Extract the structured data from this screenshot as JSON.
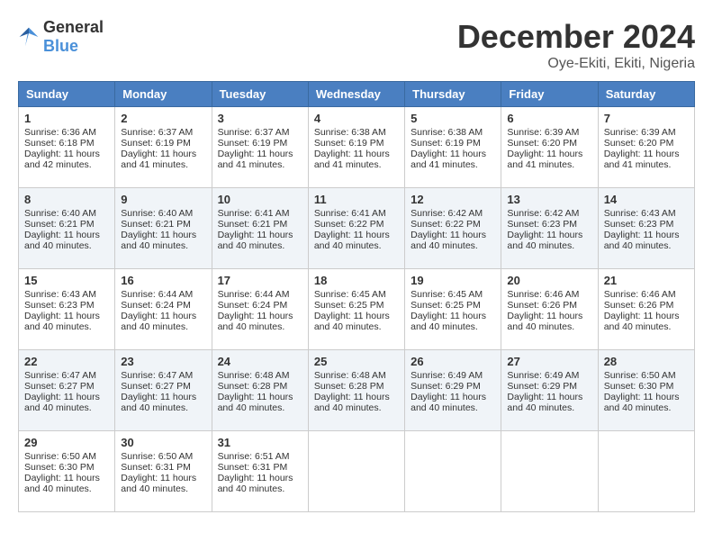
{
  "header": {
    "logo_general": "General",
    "logo_blue": "Blue",
    "month": "December 2024",
    "location": "Oye-Ekiti, Ekiti, Nigeria"
  },
  "weekdays": [
    "Sunday",
    "Monday",
    "Tuesday",
    "Wednesday",
    "Thursday",
    "Friday",
    "Saturday"
  ],
  "weeks": [
    [
      {
        "day": 1,
        "sunrise": "6:36 AM",
        "sunset": "6:18 PM",
        "daylight": "11 hours and 42 minutes."
      },
      {
        "day": 2,
        "sunrise": "6:37 AM",
        "sunset": "6:19 PM",
        "daylight": "11 hours and 41 minutes."
      },
      {
        "day": 3,
        "sunrise": "6:37 AM",
        "sunset": "6:19 PM",
        "daylight": "11 hours and 41 minutes."
      },
      {
        "day": 4,
        "sunrise": "6:38 AM",
        "sunset": "6:19 PM",
        "daylight": "11 hours and 41 minutes."
      },
      {
        "day": 5,
        "sunrise": "6:38 AM",
        "sunset": "6:19 PM",
        "daylight": "11 hours and 41 minutes."
      },
      {
        "day": 6,
        "sunrise": "6:39 AM",
        "sunset": "6:20 PM",
        "daylight": "11 hours and 41 minutes."
      },
      {
        "day": 7,
        "sunrise": "6:39 AM",
        "sunset": "6:20 PM",
        "daylight": "11 hours and 41 minutes."
      }
    ],
    [
      {
        "day": 8,
        "sunrise": "6:40 AM",
        "sunset": "6:21 PM",
        "daylight": "11 hours and 40 minutes."
      },
      {
        "day": 9,
        "sunrise": "6:40 AM",
        "sunset": "6:21 PM",
        "daylight": "11 hours and 40 minutes."
      },
      {
        "day": 10,
        "sunrise": "6:41 AM",
        "sunset": "6:21 PM",
        "daylight": "11 hours and 40 minutes."
      },
      {
        "day": 11,
        "sunrise": "6:41 AM",
        "sunset": "6:22 PM",
        "daylight": "11 hours and 40 minutes."
      },
      {
        "day": 12,
        "sunrise": "6:42 AM",
        "sunset": "6:22 PM",
        "daylight": "11 hours and 40 minutes."
      },
      {
        "day": 13,
        "sunrise": "6:42 AM",
        "sunset": "6:23 PM",
        "daylight": "11 hours and 40 minutes."
      },
      {
        "day": 14,
        "sunrise": "6:43 AM",
        "sunset": "6:23 PM",
        "daylight": "11 hours and 40 minutes."
      }
    ],
    [
      {
        "day": 15,
        "sunrise": "6:43 AM",
        "sunset": "6:23 PM",
        "daylight": "11 hours and 40 minutes."
      },
      {
        "day": 16,
        "sunrise": "6:44 AM",
        "sunset": "6:24 PM",
        "daylight": "11 hours and 40 minutes."
      },
      {
        "day": 17,
        "sunrise": "6:44 AM",
        "sunset": "6:24 PM",
        "daylight": "11 hours and 40 minutes."
      },
      {
        "day": 18,
        "sunrise": "6:45 AM",
        "sunset": "6:25 PM",
        "daylight": "11 hours and 40 minutes."
      },
      {
        "day": 19,
        "sunrise": "6:45 AM",
        "sunset": "6:25 PM",
        "daylight": "11 hours and 40 minutes."
      },
      {
        "day": 20,
        "sunrise": "6:46 AM",
        "sunset": "6:26 PM",
        "daylight": "11 hours and 40 minutes."
      },
      {
        "day": 21,
        "sunrise": "6:46 AM",
        "sunset": "6:26 PM",
        "daylight": "11 hours and 40 minutes."
      }
    ],
    [
      {
        "day": 22,
        "sunrise": "6:47 AM",
        "sunset": "6:27 PM",
        "daylight": "11 hours and 40 minutes."
      },
      {
        "day": 23,
        "sunrise": "6:47 AM",
        "sunset": "6:27 PM",
        "daylight": "11 hours and 40 minutes."
      },
      {
        "day": 24,
        "sunrise": "6:48 AM",
        "sunset": "6:28 PM",
        "daylight": "11 hours and 40 minutes."
      },
      {
        "day": 25,
        "sunrise": "6:48 AM",
        "sunset": "6:28 PM",
        "daylight": "11 hours and 40 minutes."
      },
      {
        "day": 26,
        "sunrise": "6:49 AM",
        "sunset": "6:29 PM",
        "daylight": "11 hours and 40 minutes."
      },
      {
        "day": 27,
        "sunrise": "6:49 AM",
        "sunset": "6:29 PM",
        "daylight": "11 hours and 40 minutes."
      },
      {
        "day": 28,
        "sunrise": "6:50 AM",
        "sunset": "6:30 PM",
        "daylight": "11 hours and 40 minutes."
      }
    ],
    [
      {
        "day": 29,
        "sunrise": "6:50 AM",
        "sunset": "6:30 PM",
        "daylight": "11 hours and 40 minutes."
      },
      {
        "day": 30,
        "sunrise": "6:50 AM",
        "sunset": "6:31 PM",
        "daylight": "11 hours and 40 minutes."
      },
      {
        "day": 31,
        "sunrise": "6:51 AM",
        "sunset": "6:31 PM",
        "daylight": "11 hours and 40 minutes."
      },
      null,
      null,
      null,
      null
    ]
  ]
}
